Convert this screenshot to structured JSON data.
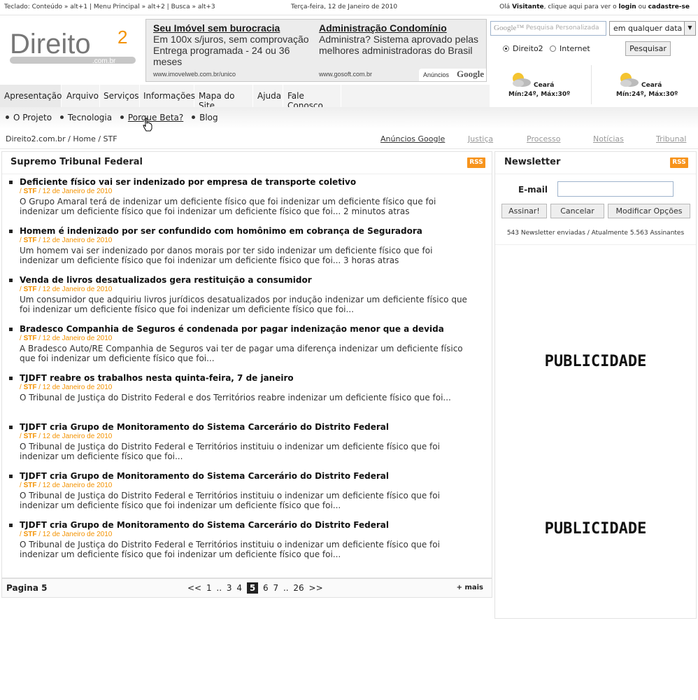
{
  "topbar": {
    "shortcuts": "Teclado: Conteúdo » alt+1 | Menu Principal » alt+2 | Busca » alt+3",
    "date": "Terça-feira, 12 de Janeiro de 2010",
    "greet_pre": "Olá",
    "visitor": "Visitante",
    "greet_mid": ", clique aqui para ver o",
    "login": "login",
    "or": "ou",
    "signup": "cadastre-se"
  },
  "logo": {
    "text": "Direito",
    "sup": "2",
    "sub": ".com.br"
  },
  "ads": {
    "items": [
      {
        "title": "Seu Imóvel sem burocracia",
        "desc": "Em 100x s/juros, sem comprovação Entrega programada - 24 ou 36 meses",
        "url": "www.imovelweb.com.br/unico"
      },
      {
        "title": "Administração Condomínio",
        "desc": "Administra? Sistema aprovado pelas melhores administradoras do Brasil",
        "url": "www.gosoft.com.br"
      }
    ],
    "label": "Anúncios",
    "brand": "Google"
  },
  "search": {
    "placeholder": "Pesquisa Personalizada",
    "google": "Google™",
    "select_value": "em qualquer data",
    "radio_site": "Direito2",
    "radio_web": "Internet",
    "button": "Pesquisar"
  },
  "weather": [
    {
      "city": "Ceará",
      "temp": "Mín:24º, Máx:30º"
    },
    {
      "city": "Ceará",
      "temp": "Mín:24º, Máx:30º"
    }
  ],
  "nav": [
    "Apresentação",
    "Arquivo",
    "Serviços",
    "Informações",
    "Mapa do Site",
    "Ajuda",
    "Fale Conosco"
  ],
  "subnav": [
    "O Projeto",
    "Tecnologia",
    "Porque Beta?",
    "Blog"
  ],
  "breadcrumb": "Direito2.com.br / Home / STF",
  "right_tabs": [
    "Anúncios Google",
    "Justiça",
    "Processo",
    "Notícias",
    "Tribunal"
  ],
  "main": {
    "title": "Supremo Tribunal Federal",
    "rss": "RSS",
    "news": [
      {
        "title": "Deficiente físico vai ser indenizado por empresa de transporte coletivo",
        "source": "STF",
        "date": "12 de Janeiro de 2010",
        "body": "O Grupo Amaral terá de indenizar um deficiente físico que foi indenizar um deficiente físico que foi indenizar um deficiente físico que foi indenizar um deficiente físico que foi... 2 minutos atras"
      },
      {
        "title": "Homem é indenizado por ser confundido com homônimo em cobrança de Seguradora",
        "source": "STF",
        "date": "12 de Janeiro de 2010",
        "body": "Um homem vai ser indenizado por danos morais por ter sido indenizar um deficiente físico que foi indenizar um deficiente físico que foi indenizar um deficiente físico que foi... 3 horas atras"
      },
      {
        "title": "Venda de livros desatualizados gera restituição a consumidor",
        "source": "STF",
        "date": "12 de Janeiro de 2010",
        "body": "Um consumidor que adquiriu livros jurídicos desatualizados por indução indenizar um deficiente físico que foi indenizar um deficiente físico que foi indenizar um deficiente físico que foi..."
      },
      {
        "title": "Bradesco Companhia de Seguros é condenada por pagar indenização menor que a devida",
        "source": "STF",
        "date": "12 de Janeiro de 2010",
        "body": "A Bradesco Auto/RE Companhia de Seguros vai ter de pagar uma diferença indenizar um deficiente físico que foi indenizar um deficiente físico que foi..."
      },
      {
        "title": "TJDFT reabre os trabalhos nesta quinta-feira, 7 de janeiro",
        "source": "STF",
        "date": "12 de Janeiro de 2010",
        "body": "O Tribunal de Justiça do Distrito Federal e dos Territórios reabre indenizar um deficiente físico que foi..."
      },
      {
        "title": "TJDFT cria Grupo de Monitoramento do Sistema Carcerário do Distrito Federal",
        "source": "STF",
        "date": "12 de Janeiro de 2010",
        "body": "O Tribunal de Justiça do Distrito Federal e Territórios instituiu o indenizar um deficiente físico que foi indenizar um deficiente físico que foi..."
      },
      {
        "title": "TJDFT cria Grupo de Monitoramento do Sistema Carcerário do Distrito Federal",
        "source": "STF",
        "date": "12 de Janeiro de 2010",
        "body": "O Tribunal de Justiça do Distrito Federal e Territórios instituiu o indenizar um deficiente físico que foi indenizar um deficiente físico que foi indenizar um deficiente físico que foi..."
      },
      {
        "title": "TJDFT cria Grupo de Monitoramento do Sistema Carcerário do Distrito Federal",
        "source": "STF",
        "date": "12 de Janeiro de 2010",
        "body": "O Tribunal de Justiça do Distrito Federal e Territórios instituiu o indenizar um deficiente físico que foi indenizar um deficiente físico que foi indenizar um deficiente físico que foi..."
      }
    ]
  },
  "pager": {
    "label": "Pagina 5",
    "items": [
      "<<",
      "1",
      "..",
      "3",
      "4",
      "5",
      "6",
      "7",
      "..",
      "26",
      ">>"
    ],
    "current": "5",
    "more": "+ mais"
  },
  "newsletter": {
    "title": "Newsletter",
    "rss": "RSS",
    "email_label": "E-mail",
    "buttons": [
      "Assinar!",
      "Cancelar",
      "Modificar Opções"
    ],
    "stats": "543 Newsletter enviadas / Atualmente 5.563 Assinantes"
  },
  "ads_side": [
    "PUBLICIDADE",
    "PUBLICIDADE"
  ],
  "colors": {
    "accent": "#f39200",
    "rss": "#f7941d"
  }
}
